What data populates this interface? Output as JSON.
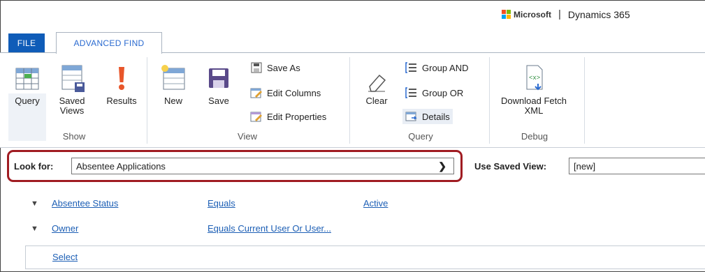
{
  "brand": {
    "ms": "Microsoft",
    "separator": "|",
    "product": "Dynamics 365"
  },
  "tabs": {
    "file": "FILE",
    "active": "ADVANCED FIND"
  },
  "ribbon": {
    "show": {
      "label": "Show",
      "query": "Query",
      "saved_views": "Saved\nViews",
      "results": "Results"
    },
    "view": {
      "label": "View",
      "new": "New",
      "save": "Save",
      "save_as": "Save As",
      "edit_columns": "Edit Columns",
      "edit_properties": "Edit Properties"
    },
    "query": {
      "label": "Query",
      "clear": "Clear",
      "group_and": "Group AND",
      "group_or": "Group OR",
      "details": "Details"
    },
    "debug": {
      "label": "Debug",
      "download_fetch": "Download Fetch\nXML"
    }
  },
  "lookfor": {
    "label": "Look for:",
    "value": "Absentee Applications"
  },
  "use_saved_view": {
    "label": "Use Saved View:",
    "value": "[new]"
  },
  "conditions": [
    {
      "field": "Absentee Status",
      "operator": "Equals",
      "value": "Active"
    },
    {
      "field": "Owner",
      "operator": "Equals Current User Or User...",
      "value": ""
    }
  ],
  "select_link": "Select",
  "colors": {
    "accent_blue": "#0f5cb8",
    "link_blue": "#1d5fb5",
    "highlight_red": "#a01c22"
  }
}
